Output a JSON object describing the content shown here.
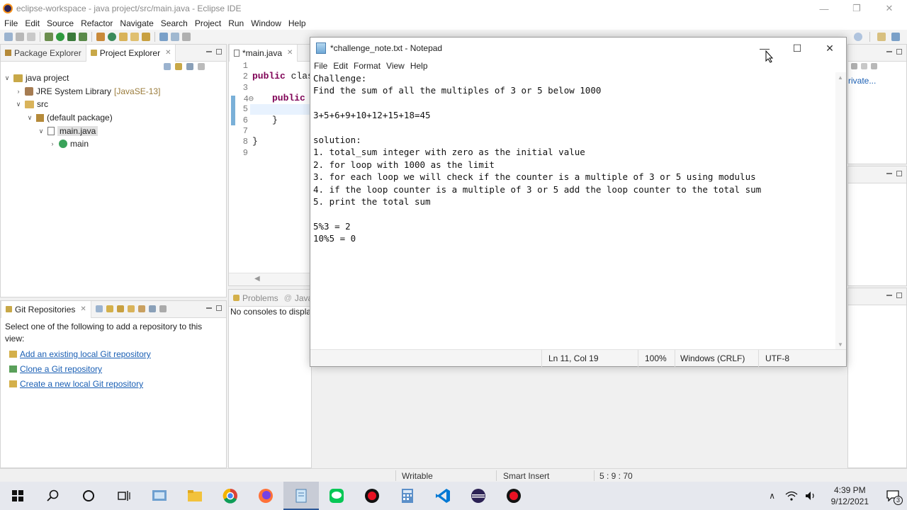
{
  "eclipse": {
    "title": "eclipse-workspace - java project/src/main.java - Eclipse IDE",
    "menu": [
      "File",
      "Edit",
      "Source",
      "Refactor",
      "Navigate",
      "Search",
      "Project",
      "Run",
      "Window",
      "Help"
    ],
    "explorer_tabs": [
      "Package Explorer",
      "Project Explorer"
    ],
    "tree": {
      "project": "java project",
      "jre": "JRE System Library",
      "jre_version": "[JavaSE-13]",
      "src": "src",
      "package": "(default package)",
      "file": "main.java",
      "method": "main"
    },
    "editor_tab": "*main.java",
    "line_numbers": [
      "1",
      "2",
      "3",
      "4⊖",
      "5",
      "6",
      "7",
      "8",
      "9"
    ],
    "code": {
      "l2_kw": "public",
      "l2_rest": " clas",
      "l4_kw": "public",
      "l6": "}",
      "l8": "}"
    },
    "git": {
      "tab": "Git Repositories",
      "intro": "Select one of the following to add a repository to this view:",
      "links": [
        "Add an existing local Git repository",
        "Clone a Git repository",
        "Create a new local Git repository"
      ]
    },
    "console": {
      "tabs": [
        "Problems",
        "Javad"
      ],
      "message": "No consoles to displa"
    },
    "right_partial": "rivate...",
    "status": {
      "writable": "Writable",
      "insert": "Smart Insert",
      "position": "5 : 9 : 70"
    }
  },
  "notepad": {
    "title": "*challenge_note.txt - Notepad",
    "menu": [
      "File",
      "Edit",
      "Format",
      "View",
      "Help"
    ],
    "text": "Challenge:\nFind the sum of all the multiples of 3 or 5 below 1000\n\n3+5+6+9+10+12+15+18=45\n\nsolution:\n1. total_sum integer with zero as the initial value\n2. for loop with 1000 as the limit\n3. for each loop we will check if the counter is a multiple of 3 or 5 using modulus\n4. if the loop counter is a multiple of 3 or 5 add the loop counter to the total sum\n5. print the total sum\n\n5%3 = 2\n10%5 = 0",
    "status": {
      "position": "Ln 11, Col 19",
      "zoom": "100%",
      "line_ending": "Windows (CRLF)",
      "encoding": "UTF-8"
    }
  },
  "taskbar": {
    "time": "4:39 PM",
    "date": "9/12/2021",
    "notifications": "3"
  }
}
